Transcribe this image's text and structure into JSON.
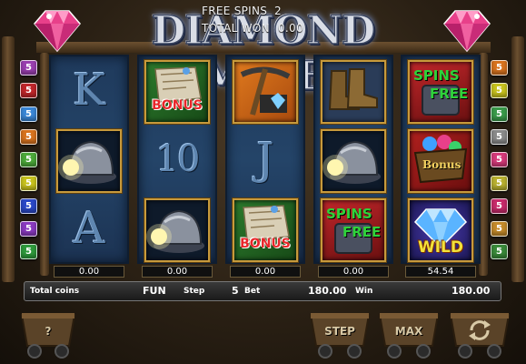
{
  "game": {
    "title": "DIAMOND MINE"
  },
  "top_info": {
    "free_spins_label": "FREE SPINS",
    "free_spins_value": "2",
    "total_won_label": "TOTAL WON",
    "total_won_value": "0.00"
  },
  "paylines_left": [
    {
      "label": "5",
      "color": "#9a3fb0"
    },
    {
      "label": "5",
      "color": "#c0262a"
    },
    {
      "label": "5",
      "color": "#3a86d6"
    },
    {
      "label": "5",
      "color": "#d8731e"
    },
    {
      "label": "5",
      "color": "#4caa3a"
    },
    {
      "label": "5",
      "color": "#c8c21e"
    },
    {
      "label": "5",
      "color": "#2a48c8"
    },
    {
      "label": "5",
      "color": "#8a3ac0"
    },
    {
      "label": "5",
      "color": "#2e9a3c"
    }
  ],
  "paylines_right": [
    {
      "label": "5",
      "color": "#d8731e"
    },
    {
      "label": "5",
      "color": "#c8c21e"
    },
    {
      "label": "5",
      "color": "#3a9a4a"
    },
    {
      "label": "5",
      "color": "#8a8a8a"
    },
    {
      "label": "5",
      "color": "#d63a7a"
    },
    {
      "label": "5",
      "color": "#b8b030"
    },
    {
      "label": "5",
      "color": "#c82a6a"
    },
    {
      "label": "5",
      "color": "#c48a2a"
    },
    {
      "label": "5",
      "color": "#3a8a3a"
    }
  ],
  "reels": [
    {
      "symbols": [
        {
          "type": "letter",
          "text": "K"
        },
        {
          "type": "helmet"
        },
        {
          "type": "letter",
          "text": "A"
        }
      ],
      "win": "0.00"
    },
    {
      "symbols": [
        {
          "type": "bonus-map",
          "text": "BONUS"
        },
        {
          "type": "letter",
          "text": "10"
        },
        {
          "type": "helmet"
        }
      ],
      "win": "0.00"
    },
    {
      "symbols": [
        {
          "type": "pickaxe"
        },
        {
          "type": "letter",
          "text": "J"
        },
        {
          "type": "bonus-map",
          "text": "BONUS"
        }
      ],
      "win": "0.00"
    },
    {
      "symbols": [
        {
          "type": "boots"
        },
        {
          "type": "helmet"
        },
        {
          "type": "free-spins",
          "text_top": "SPINS",
          "text_bottom": "FREE"
        }
      ],
      "win": "0.00"
    },
    {
      "symbols": [
        {
          "type": "free-spins",
          "text_top": "SPINS",
          "text_bottom": "FREE"
        },
        {
          "type": "bonus-cart",
          "text": "Bonus"
        },
        {
          "type": "wild-diamond",
          "text": "WILD"
        }
      ],
      "win": "54.54"
    }
  ],
  "status_bar": {
    "total_coins_label": "Total coins",
    "fun_label": "FUN",
    "step_label": "Step",
    "step_value": "5",
    "bet_label": "Bet",
    "bet_value": "180.00",
    "win_label": "Win",
    "win_value": "180.00"
  },
  "controls": {
    "help_label": "?",
    "step_label": "STEP",
    "max_label": "MAX",
    "spin_icon": "circular-arrows-icon"
  },
  "colors": {
    "title_fill": "#d9dde6",
    "reel_bg": "#244468",
    "frame_gold": "#c79a3c",
    "gem_pink": "#e8408a"
  }
}
